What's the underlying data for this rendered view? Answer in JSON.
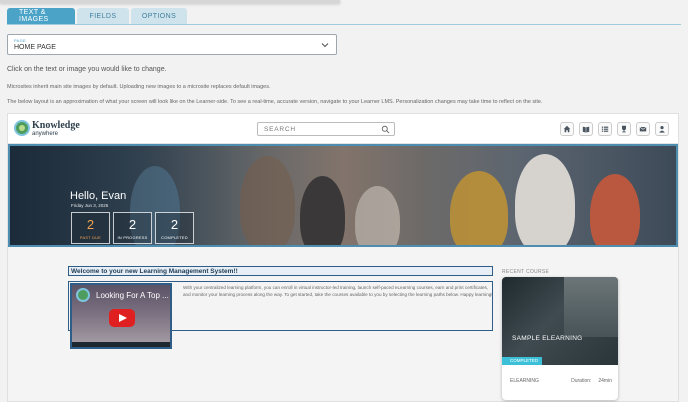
{
  "tabs": [
    {
      "label": "TEXT & IMAGES",
      "active": true
    },
    {
      "label": "FIELDS",
      "active": false
    },
    {
      "label": "OPTIONS",
      "active": false
    }
  ],
  "page_select": {
    "label": "PAGE",
    "value": "HOME PAGE"
  },
  "instructions": {
    "line1": "Click on the text or image you would like to change.",
    "line2": "Microsites inherit main site images by default. Uploading new images to a microsite replaces default images.",
    "line3": "The below layout is an approximation of what your screen will look like on the Learner-side. To see a real-time, accurate version, navigate to your Learner LMS. Personalization changes may take time to reflect on the site."
  },
  "preview": {
    "logo": {
      "main": "Knowledge",
      "sub": "anywhere"
    },
    "search_placeholder": "SEARCH",
    "header_icons": [
      "home-icon",
      "book-icon",
      "list-icon",
      "trophy-icon",
      "mail-icon",
      "user-icon"
    ],
    "banner": {
      "greeting": "Hello, Evan",
      "date": "Friday Jun 3, 2025",
      "stats": [
        {
          "value": "2",
          "label": "PAST DUE"
        },
        {
          "value": "2",
          "label": "IN PROGRESS"
        },
        {
          "value": "2",
          "label": "COMPLETED"
        }
      ]
    },
    "welcome_title": "Welcome to your new Learning Management System!!",
    "welcome_text": "With your centralized learning platform, you can enroll in virtual instructor-led training, launch self-paced eLearning courses, earn and print certificates, and monitor your learning process along the way. To get started, take the courses available to you by selecting the learning paths below. Happy learning!",
    "video_title": "Looking For A Top ...",
    "recent_course": {
      "section_label": "RECENT COURSE",
      "title": "SAMPLE ELEARNING",
      "status": "COMPLETED",
      "type": "ELEARNING",
      "duration_label": "Duration:",
      "duration_value": "24min"
    }
  },
  "colors": {
    "accent": "#4ca3c8",
    "past_due": "#f0a250",
    "completed_badge": "#3cc0d8",
    "border_blue": "#2e5e88"
  }
}
